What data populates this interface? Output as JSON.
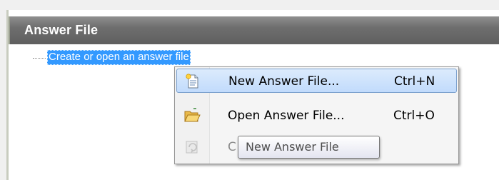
{
  "pane": {
    "title": "Answer File"
  },
  "tree": {
    "node_label": "Create or open an answer file"
  },
  "context_menu": {
    "items": [
      {
        "label": "New Answer File...",
        "shortcut": "Ctrl+N",
        "icon": "new-file-icon",
        "state": "highlighted"
      },
      {
        "label": "Open Answer File...",
        "shortcut": "Ctrl+O",
        "icon": "open-folder-icon",
        "state": "normal"
      },
      {
        "label": "C",
        "shortcut": "",
        "icon": "close-file-icon",
        "state": "disabled"
      }
    ]
  },
  "tooltip": {
    "text": "New Answer File"
  },
  "colors": {
    "selection": "#3399ff",
    "menu_highlight_border": "#7da2ce",
    "header_bg": "#6e6e6e"
  }
}
